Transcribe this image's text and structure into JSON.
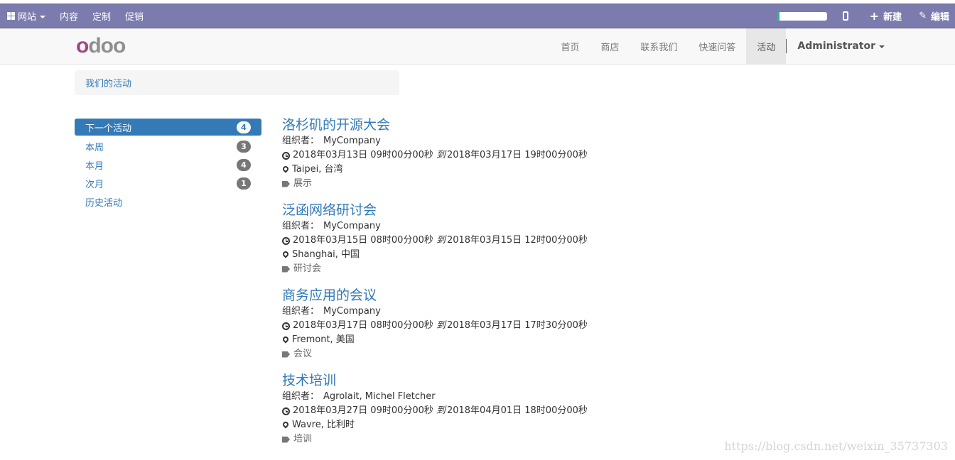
{
  "adminbar": {
    "menu": [
      {
        "label": "网站",
        "has_caret": true
      },
      {
        "label": "内容"
      },
      {
        "label": "定制"
      },
      {
        "label": "促销"
      }
    ],
    "progress_fraction": 0.05,
    "progress_color": "#21b799",
    "new_label": "新建",
    "edit_label": "编辑",
    "background_color": "#7c7bad"
  },
  "navbar": {
    "logo_letters": [
      "o",
      "d",
      "o",
      "o"
    ],
    "logo_colors": [
      "#a24689",
      "#8f8f8f",
      "#8f8f8f",
      "#8f8f8f"
    ],
    "links": [
      "首页",
      "商店",
      "联系我们",
      "快速问答",
      "活动"
    ],
    "active_link": "活动",
    "user": "Administrator"
  },
  "breadcrumb": {
    "label": "我们的活动"
  },
  "sidebar": {
    "items": [
      {
        "label": "下一个活动",
        "count": "4",
        "active": true
      },
      {
        "label": "本周",
        "count": "3"
      },
      {
        "label": "本月",
        "count": "4"
      },
      {
        "label": "次月",
        "count": "1"
      },
      {
        "label": "历史活动",
        "count": ""
      }
    ]
  },
  "events": [
    {
      "title": "洛杉矶的开源大会",
      "organizer_label": "组织者：",
      "organizer": "MyCompany",
      "start": "2018年03月13日 09时00分00秒",
      "to": "到",
      "end": "2018年03月17日 19时00分00秒",
      "location": "Taipei, 台湾",
      "tag": "展示"
    },
    {
      "title": "泛函网络研讨会",
      "organizer_label": "组织者：",
      "organizer": "MyCompany",
      "start": "2018年03月15日 08时00分00秒",
      "to": "到",
      "end": "2018年03月15日 12时00分00秒",
      "location": "Shanghai, 中国",
      "tag": "研讨会"
    },
    {
      "title": "商务应用的会议",
      "organizer_label": "组织者：",
      "organizer": "MyCompany",
      "start": "2018年03月17日 08时00分00秒",
      "to": "到",
      "end": "2018年03月17日 17时30分00秒",
      "location": "Fremont, 美国",
      "tag": "会议"
    },
    {
      "title": "技术培训",
      "organizer_label": "组织者：",
      "organizer": "Agrolait, Michel Fletcher",
      "start": "2018年03月27日 09时00分00秒",
      "to": "到",
      "end": "2018年04月01日 18时00分00秒",
      "location": "Wavre, 比利时",
      "tag": "培训"
    }
  ],
  "watermark": "https://blog.csdn.net/weixin_35737303"
}
